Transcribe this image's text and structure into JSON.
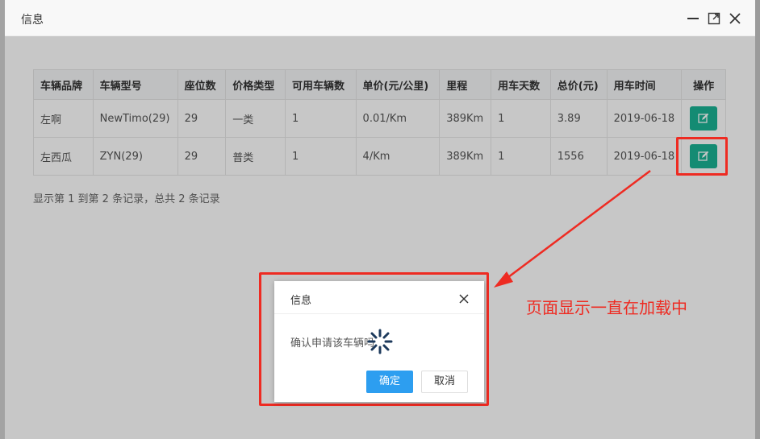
{
  "window": {
    "title": "信息",
    "icons": {
      "minimize": "minimize-icon",
      "maximize": "maximize-icon",
      "close": "close-icon"
    }
  },
  "table": {
    "headers": [
      "车辆品牌",
      "车辆型号",
      "座位数",
      "价格类型",
      "可用车辆数",
      "单价(元/公里)",
      "里程",
      "用车天数",
      "总价(元)",
      "用车时间",
      "操作"
    ],
    "rows": [
      [
        "左啊",
        "NewTimo(29)",
        "29",
        "一类",
        "1",
        "0.01/Km",
        "389Km",
        "1",
        "3.89",
        "2019-06-18"
      ],
      [
        "左西瓜",
        "ZYN(29)",
        "29",
        "普类",
        "1",
        "4/Km",
        "389Km",
        "1",
        "1556",
        "2019-06-18"
      ]
    ],
    "action_icon": "edit-icon",
    "action_color": "#1ab394"
  },
  "footer": {
    "info": "显示第 1 到第 2 条记录，总共 2 条记录"
  },
  "dialog": {
    "title": "信息",
    "message": "确认申请该车辆吗",
    "ok_label": "确定",
    "cancel_label": "取消",
    "ok_color": "#2d9ef0"
  },
  "annotation": {
    "text": "页面显示一直在加载中",
    "color": "#ee2b22"
  }
}
